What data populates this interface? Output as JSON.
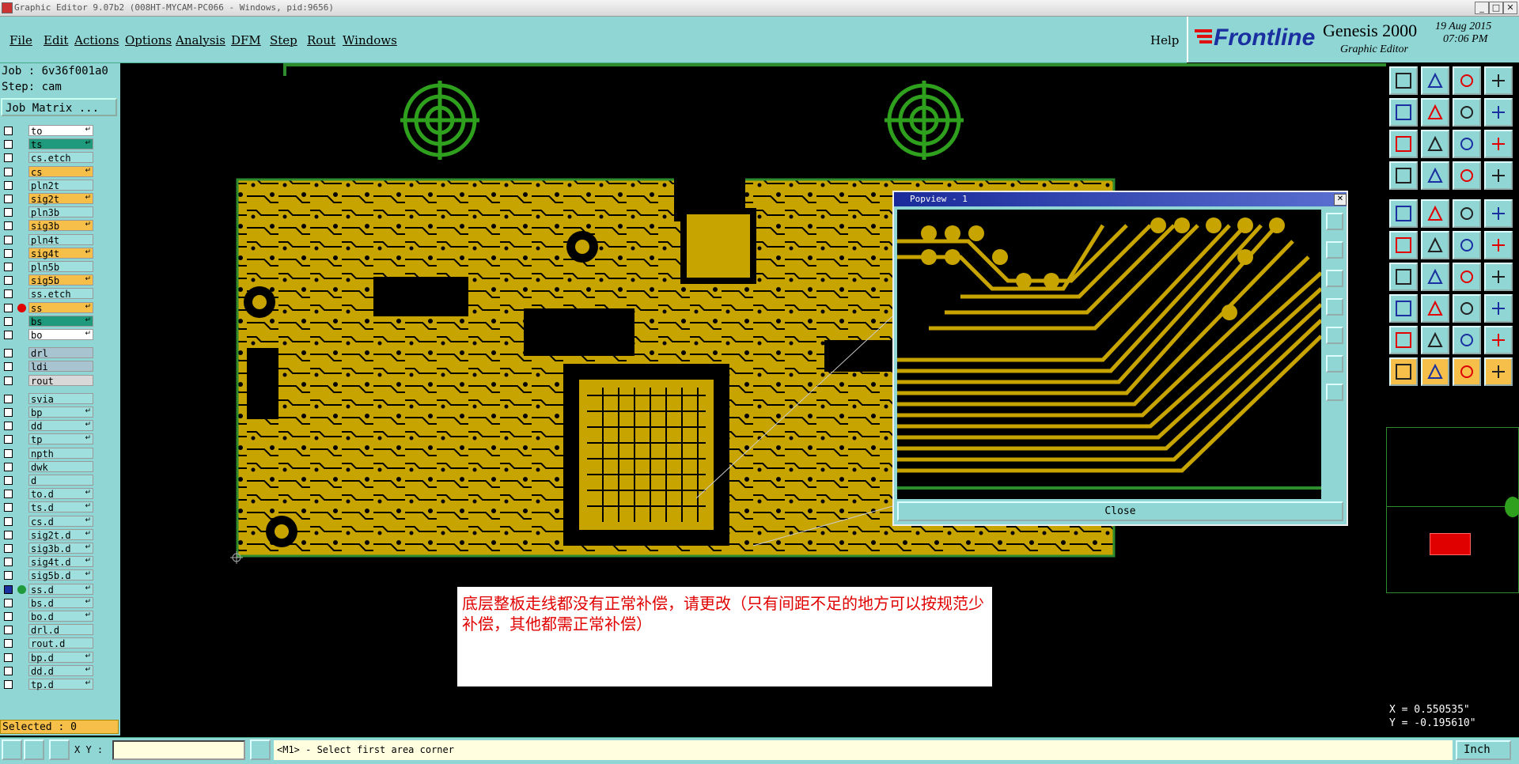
{
  "window": {
    "title": "Graphic Editor 9.07b2 (008HT-MYCAM-PC066 - Windows, pid:9656)",
    "min_label": "_",
    "max_label": "□",
    "close_label": "✕"
  },
  "menu": {
    "items": [
      "File",
      "Edit",
      "Actions",
      "Options",
      "Analysis",
      "DFM",
      "Step",
      "Rout",
      "Windows"
    ],
    "help": "Help"
  },
  "brand": {
    "logo": "Frontline",
    "product": "Genesis 2000",
    "subtitle": "Graphic Editor",
    "date": "19 Aug 2015",
    "time": "07:06 PM"
  },
  "job": {
    "job_line": "Job : 6v36f001a0",
    "step_line": "Step: cam",
    "matrix_button": "Job Matrix ..."
  },
  "layers": [
    {
      "name": "to",
      "color": "#ffffff",
      "mark": "↵"
    },
    {
      "name": "ts",
      "color": "#1f9a7c",
      "mark": "↵"
    },
    {
      "name": "cs.etch",
      "color": "#9fe0de",
      "mark": ""
    },
    {
      "name": "cs",
      "color": "#f5bf4a",
      "mark": "↵"
    },
    {
      "name": "pln2t",
      "color": "#9fe0de",
      "mark": ""
    },
    {
      "name": "sig2t",
      "color": "#f5bf4a",
      "mark": "↵"
    },
    {
      "name": "pln3b",
      "color": "#9fe0de",
      "mark": ""
    },
    {
      "name": "sig3b",
      "color": "#f5bf4a",
      "mark": "↵"
    },
    {
      "name": "pln4t",
      "color": "#9fe0de",
      "mark": ""
    },
    {
      "name": "sig4t",
      "color": "#f5bf4a",
      "mark": "↵"
    },
    {
      "name": "pln5b",
      "color": "#9fe0de",
      "mark": ""
    },
    {
      "name": "sig5b",
      "color": "#f5bf4a",
      "mark": "↵"
    },
    {
      "name": "ss.etch",
      "color": "#9fe0de",
      "mark": ""
    },
    {
      "name": "ss",
      "color": "#f5bf4a",
      "mark": "↵",
      "dot": "#e00000"
    },
    {
      "name": "bs",
      "color": "#1f9a7c",
      "mark": "↵"
    },
    {
      "name": "bo",
      "color": "#ffffff",
      "mark": "↵"
    },
    {
      "name": "drl",
      "color": "#a8c4d0",
      "mark": ""
    },
    {
      "name": "ldi",
      "color": "#a8c4d0",
      "mark": ""
    },
    {
      "name": "rout",
      "color": "#d8d8d8",
      "mark": ""
    },
    {
      "name": "svia",
      "color": "#9fe0de",
      "mark": ""
    },
    {
      "name": "bp",
      "color": "#9fe0de",
      "mark": "↵"
    },
    {
      "name": "dd",
      "color": "#9fe0de",
      "mark": "↵"
    },
    {
      "name": "tp",
      "color": "#9fe0de",
      "mark": "↵"
    },
    {
      "name": "npth",
      "color": "#9fe0de",
      "mark": ""
    },
    {
      "name": "dwk",
      "color": "#9fe0de",
      "mark": ""
    },
    {
      "name": "d",
      "color": "#9fe0de",
      "mark": ""
    },
    {
      "name": "to.d",
      "color": "#9fe0de",
      "mark": "↵"
    },
    {
      "name": "ts.d",
      "color": "#9fe0de",
      "mark": "↵"
    },
    {
      "name": "cs.d",
      "color": "#9fe0de",
      "mark": "↵"
    },
    {
      "name": "sig2t.d",
      "color": "#9fe0de",
      "mark": "↵"
    },
    {
      "name": "sig3b.d",
      "color": "#9fe0de",
      "mark": "↵"
    },
    {
      "name": "sig4t.d",
      "color": "#9fe0de",
      "mark": "↵"
    },
    {
      "name": "sig5b.d",
      "color": "#9fe0de",
      "mark": "↵"
    },
    {
      "name": "ss.d",
      "color": "#9fe0de",
      "mark": "↵",
      "dot": "#1f9a3c",
      "active": true
    },
    {
      "name": "bs.d",
      "color": "#9fe0de",
      "mark": "↵"
    },
    {
      "name": "bo.d",
      "color": "#9fe0de",
      "mark": "↵"
    },
    {
      "name": "drl.d",
      "color": "#9fe0de",
      "mark": ""
    },
    {
      "name": "rout.d",
      "color": "#9fe0de",
      "mark": ""
    },
    {
      "name": "bp.d",
      "color": "#9fe0de",
      "mark": "↵"
    },
    {
      "name": "dd.d",
      "color": "#9fe0de",
      "mark": "↵"
    },
    {
      "name": "tp.d",
      "color": "#9fe0de",
      "mark": "↵"
    }
  ],
  "selected": "Selected : 0",
  "popview": {
    "title": "Popview - 1",
    "close_label": "Close"
  },
  "note": {
    "text": "底层整板走线都没有正常补偿，请更改（只有间距不足的地方可以按规范少补偿，其他都需正常补偿）"
  },
  "coords": {
    "x": "X = 0.550535\"",
    "y": "Y = -0.195610\""
  },
  "status": {
    "xy_label": "X Y :",
    "prompt": "<M1> - Select first area corner",
    "units": "Inch"
  },
  "colors": {
    "panel": "#8fd6d4",
    "copper": "#c8a400",
    "board_outline": "#2e8b2e",
    "target": "#2fa01e",
    "note_text": "#e00000"
  }
}
